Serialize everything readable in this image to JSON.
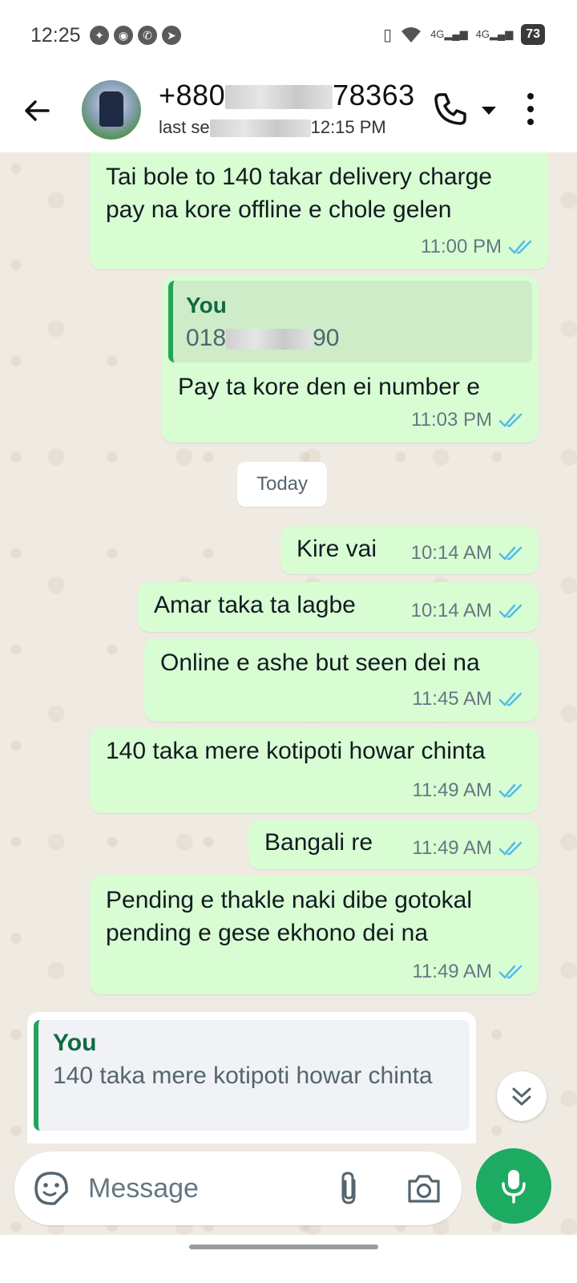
{
  "status_bar": {
    "time": "12:25",
    "battery": "73",
    "network": "4G"
  },
  "header": {
    "name_prefix": "+880",
    "name_suffix": "78363",
    "status_prefix": "last se",
    "status_suffix": "12:15 PM"
  },
  "messages": [
    {
      "text": "Tai bole to 140 takar delivery charge pay na kore offline e chole gelen",
      "time": "11:00 PM"
    },
    {
      "quote_author": "You",
      "quote_prefix": "018",
      "quote_suffix": "90",
      "text": "Pay ta kore den ei number e",
      "time": "11:03 PM"
    },
    {
      "text": "Kire vai",
      "time": "10:14 AM"
    },
    {
      "text": "Amar taka ta lagbe",
      "time": "10:14 AM"
    },
    {
      "text": "Online e ashe but seen dei na",
      "time": "11:45 AM"
    },
    {
      "text": "140 taka mere kotipoti howar chinta",
      "time": "11:49 AM"
    },
    {
      "text": "Bangali re",
      "time": "11:49 AM"
    },
    {
      "text": "Pending e thakle naki dibe gotokal pending e gese ekhono dei na",
      "time": "11:49 AM"
    }
  ],
  "date_chip": "Today",
  "reply": {
    "author": "You",
    "text": "140 taka mere kotipoti howar chinta"
  },
  "composer": {
    "placeholder": "Message"
  },
  "colors": {
    "bubble": "#d9fdd3",
    "accent": "#1daa61",
    "tick": "#53bdeb"
  }
}
